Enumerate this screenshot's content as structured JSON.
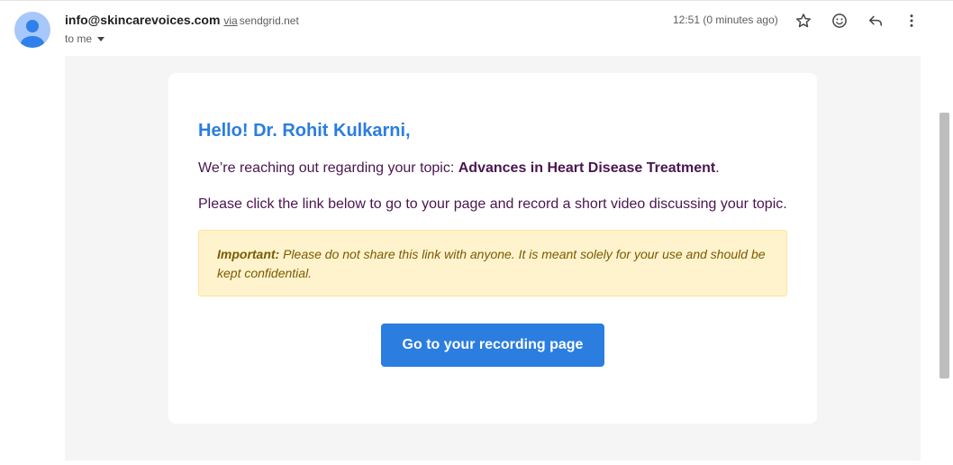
{
  "header": {
    "sender_email": "info@skincarevoices.com",
    "via_label": "via",
    "via_domain": "sendgrid.net",
    "to_label": "to me",
    "timestamp": "12:51 (0 minutes ago)",
    "icons": [
      "star-icon",
      "emoji-icon",
      "reply-icon",
      "more-vert-icon"
    ]
  },
  "email": {
    "greeting": "Hello! Dr. Rohit Kulkarni,",
    "intro_prefix": "We’re reaching out regarding your topic: ",
    "topic": "Advances in Heart Disease Treatment",
    "intro_suffix": ".",
    "instruction": "Please click the link below to go to your page and record a short video discussing your topic.",
    "notice_label": "Important:",
    "notice_text": " Please do not share this link with anyone. It is meant solely for your use and should be kept confidential.",
    "cta_label": "Go to your recording page"
  },
  "colors": {
    "accent": "#2b7de0",
    "body_text": "#4a1550",
    "notice_bg": "#fff3cd",
    "notice_text": "#7a5a00"
  }
}
